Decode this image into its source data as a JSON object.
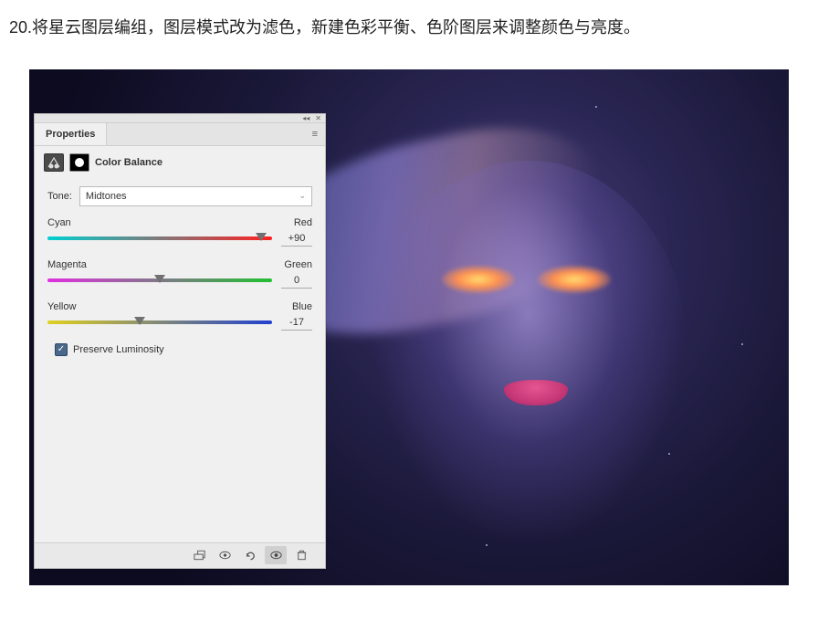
{
  "instruction": "20.将星云图层编组，图层模式改为滤色，新建色彩平衡、色阶图层来调整颜色与亮度。",
  "panel": {
    "tab_label": "Properties",
    "adjustment_title": "Color Balance",
    "tone_label": "Tone:",
    "tone_value": "Midtones",
    "sliders": [
      {
        "left": "Cyan",
        "right": "Red",
        "value": "+90",
        "pos": 95,
        "track": "track-cyanred"
      },
      {
        "left": "Magenta",
        "right": "Green",
        "value": "0",
        "pos": 50,
        "track": "track-maggreen"
      },
      {
        "left": "Yellow",
        "right": "Blue",
        "value": "-17",
        "pos": 41,
        "track": "track-yellblue"
      }
    ],
    "preserve_label": "Preserve Luminosity",
    "preserve_checked": true
  }
}
